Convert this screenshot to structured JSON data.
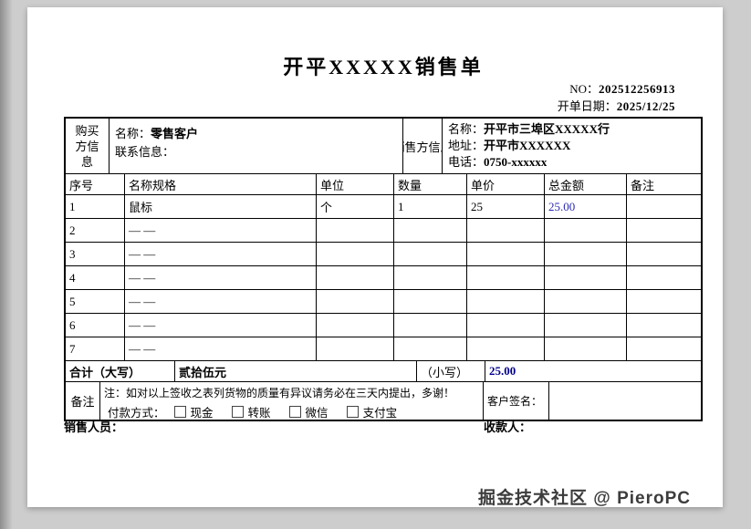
{
  "header": {
    "title": "开平XXXXX销售单",
    "no_label": "NO：",
    "no_value": "202512256913",
    "date_label": "开单日期：",
    "date_value": "2025/12/25"
  },
  "parties": {
    "buyer": {
      "label": "购买方信息",
      "name_label": "名称：",
      "name": "零售客户",
      "contact_label": "联系信息：",
      "contact": ""
    },
    "seller": {
      "label": "销售方信息",
      "name_label": "名称：",
      "name": "开平市三埠区XXXXX行",
      "address_label": "地址：",
      "address": "开平市XXXXXX",
      "phone_label": "电话：",
      "phone": "0750-xxxxxx"
    }
  },
  "items": {
    "headers": [
      "序号",
      "名称规格",
      "单位",
      "数量",
      "单价",
      "总金额",
      "备注"
    ],
    "rows": [
      {
        "no": "1",
        "name": "鼠标",
        "unit": "个",
        "qty": "1",
        "price": "25",
        "amount": "25.00",
        "note": ""
      },
      {
        "no": "2",
        "name": "— —",
        "unit": "",
        "qty": "",
        "price": "",
        "amount": "",
        "note": ""
      },
      {
        "no": "3",
        "name": "— —",
        "unit": "",
        "qty": "",
        "price": "",
        "amount": "",
        "note": ""
      },
      {
        "no": "4",
        "name": "— —",
        "unit": "",
        "qty": "",
        "price": "",
        "amount": "",
        "note": ""
      },
      {
        "no": "5",
        "name": "— —",
        "unit": "",
        "qty": "",
        "price": "",
        "amount": "",
        "note": ""
      },
      {
        "no": "6",
        "name": "— —",
        "unit": "",
        "qty": "",
        "price": "",
        "amount": "",
        "note": ""
      },
      {
        "no": "7",
        "name": "— —",
        "unit": "",
        "qty": "",
        "price": "",
        "amount": "",
        "note": ""
      }
    ]
  },
  "total": {
    "label": "合计（大写）",
    "words": "贰拾伍元",
    "lower_label": "（小写）",
    "amount": "25.00"
  },
  "remarks": {
    "label": "备注",
    "note": "注：如对以上签收之表列货物的质量有异议请务必在三天内提出，多谢！",
    "payment_label": "付款方式：",
    "payment_options": [
      "现金",
      "转账",
      "微信",
      "支付宝"
    ],
    "signature_label": "客户签名："
  },
  "footer": {
    "sales_label": "销售人员：",
    "payee_label": "收款人："
  },
  "watermark": "掘金技术社区 @ PieroPC",
  "colors": {
    "amount_blue": "#2a2ab4",
    "total_navy": "#00008b"
  }
}
